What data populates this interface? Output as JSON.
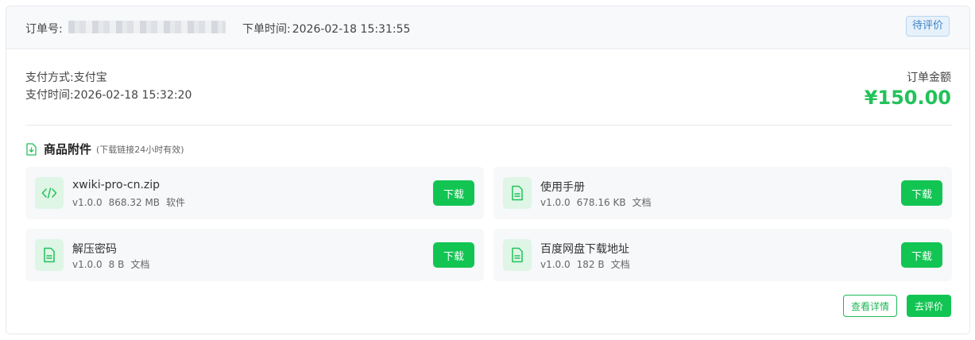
{
  "header": {
    "order_no_label": "订单号:",
    "order_time_label": "下单时间:",
    "order_time_value": "2026-02-18 15:31:55",
    "status": "待评价"
  },
  "payment": {
    "method_label": "支付方式:",
    "method_value": "支付宝",
    "time_label": "支付时间:",
    "time_value": "2026-02-18 15:32:20"
  },
  "amount": {
    "label": "订单金额",
    "value": "¥150.00"
  },
  "attachments": {
    "title": "商品附件",
    "hint": "(下载链接24小时有效)",
    "download_label": "下载",
    "items": [
      {
        "name": "xwiki-pro-cn.zip",
        "version": "v1.0.0",
        "size": "868.32 MB",
        "type": "软件",
        "icon": "code-icon"
      },
      {
        "name": "使用手册",
        "version": "v1.0.0",
        "size": "678.16 KB",
        "type": "文档",
        "icon": "document-icon"
      },
      {
        "name": "解压密码",
        "version": "v1.0.0",
        "size": "8 B",
        "type": "文档",
        "icon": "document-icon"
      },
      {
        "name": "百度网盘下载地址",
        "version": "v1.0.0",
        "size": "182 B",
        "type": "文档",
        "icon": "document-icon"
      }
    ]
  },
  "actions": {
    "detail_label": "查看详情",
    "review_label": "去评价"
  },
  "colors": {
    "accent_green": "#12c553",
    "amount_green": "#22c25a",
    "status_blue": "#3b82c4"
  }
}
